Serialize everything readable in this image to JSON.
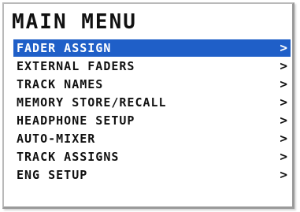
{
  "title": "MAIN MENU",
  "selected_index": 0,
  "chevron": ">",
  "colors": {
    "selection": "#1f5fc8",
    "text": "#111111",
    "selected_text": "#ffffff"
  },
  "menu": {
    "items": [
      {
        "label": "FADER ASSIGN"
      },
      {
        "label": "EXTERNAL FADERS"
      },
      {
        "label": "TRACK NAMES"
      },
      {
        "label": "MEMORY STORE/RECALL"
      },
      {
        "label": "HEADPHONE SETUP"
      },
      {
        "label": "AUTO-MIXER"
      },
      {
        "label": "TRACK ASSIGNS"
      },
      {
        "label": "ENG SETUP"
      }
    ]
  }
}
